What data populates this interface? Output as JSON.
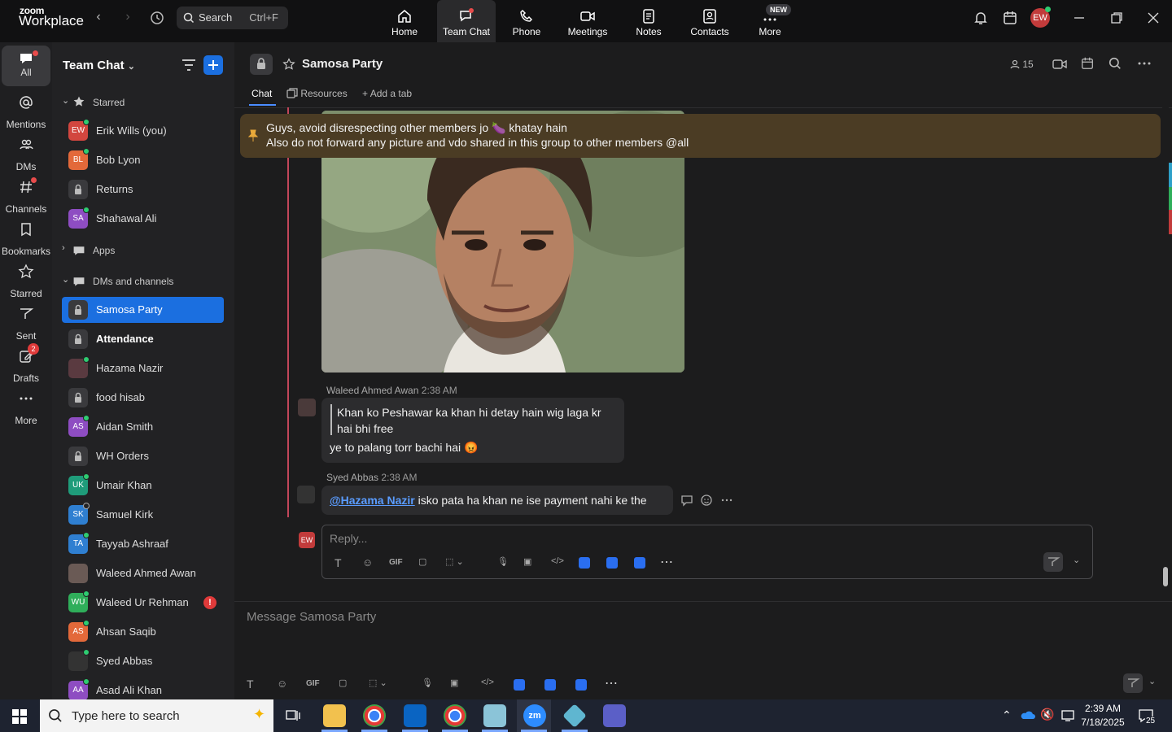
{
  "app": {
    "logo_top": "zoom",
    "logo_bottom": "Workplace"
  },
  "topbar": {
    "search_label": "Search",
    "search_shortcut": "Ctrl+F",
    "tabs": [
      {
        "label": "Home"
      },
      {
        "label": "Team Chat"
      },
      {
        "label": "Phone"
      },
      {
        "label": "Meetings"
      },
      {
        "label": "Notes"
      },
      {
        "label": "Contacts"
      },
      {
        "label": "More"
      }
    ],
    "new_badge": "NEW",
    "user_initials": "EW"
  },
  "rail": {
    "items": [
      {
        "label": "All"
      },
      {
        "label": "Mentions"
      },
      {
        "label": "DMs"
      },
      {
        "label": "Channels"
      },
      {
        "label": "Bookmarks"
      },
      {
        "label": "Starred"
      },
      {
        "label": "Sent"
      },
      {
        "label": "Drafts",
        "badge": "2"
      },
      {
        "label": "More"
      }
    ]
  },
  "sidebar": {
    "title": "Team Chat",
    "sections": {
      "starred": "Starred",
      "apps": "Apps",
      "dms": "DMs and channels"
    },
    "starred": [
      {
        "name": "Erik Wills (you)",
        "initials": "EW",
        "color": "#d2463f"
      },
      {
        "name": "Bob Lyon",
        "initials": "BL",
        "color": "#e3693a"
      },
      {
        "name": "Returns",
        "initials": ""
      },
      {
        "name": "Shahawal Ali",
        "initials": "SA",
        "color": "#8e4dc2"
      }
    ],
    "dms": [
      {
        "name": "Samosa Party"
      },
      {
        "name": "Attendance"
      },
      {
        "name": "Hazama Nazir"
      },
      {
        "name": "food hisab"
      },
      {
        "name": "Aidan Smith",
        "initials": "AS",
        "color": "#8e4dc2"
      },
      {
        "name": "WH Orders"
      },
      {
        "name": "Umair Khan",
        "initials": "UK",
        "color": "#1f9c7a"
      },
      {
        "name": "Samuel Kirk",
        "initials": "SK",
        "color": "#2f7fd1"
      },
      {
        "name": "Tayyab Ashraaf",
        "initials": "TA",
        "color": "#2f7fd1"
      },
      {
        "name": "Waleed Ahmed Awan"
      },
      {
        "name": "Waleed Ur Rehman",
        "initials": "WU",
        "color": "#2fae5a"
      },
      {
        "name": "Ahsan Saqib",
        "initials": "AS",
        "color": "#e3693a"
      },
      {
        "name": "Syed Abbas"
      },
      {
        "name": "Asad Ali Khan",
        "initials": "AA",
        "color": "#8e4dc2"
      }
    ]
  },
  "channel": {
    "title": "Samosa Party",
    "member_count": "15",
    "tabs": {
      "chat": "Chat",
      "resources": "Resources",
      "add": "Add a tab"
    },
    "pinned_line1": "Guys, avoid disrespecting other members jo 🍆 khatay hain",
    "pinned_line2": "Also do not forward any picture and vdo shared in this group to other members @all"
  },
  "messages": [
    {
      "sender": "Waleed Ahmed Awan",
      "time": "2:38 AM",
      "quote_line1": "Khan ko Peshawar ka khan hi detay hain wig laga kr",
      "quote_line2": "hai bhi free",
      "text": "ye to palang torr bachi hai 😡"
    },
    {
      "sender": "Syed Abbas",
      "time": "2:38 AM",
      "mention": "@Hazama Nazir",
      "text": " isko pata ha khan ne ise payment nahi ke the"
    }
  ],
  "reply": {
    "placeholder": "Reply...",
    "avatar": "EW"
  },
  "composer": {
    "placeholder": "Message Samosa Party"
  },
  "taskbar": {
    "search_placeholder": "Type here to search",
    "time": "2:39 AM",
    "date": "7/18/2025",
    "notif_count": "25"
  },
  "colors": {
    "accent": "#1b6fe0",
    "pinned_bg": "#4b3c24",
    "thread_bar": "#c2465a"
  }
}
